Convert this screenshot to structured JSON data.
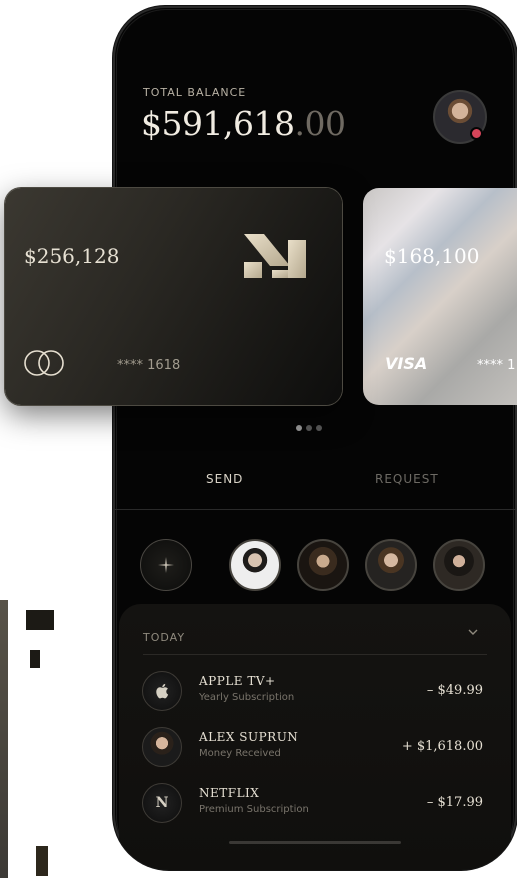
{
  "balance": {
    "label": "TOTAL BALANCE",
    "amount_main": "$591,618",
    "amount_cents": ".00"
  },
  "cards": [
    {
      "amount": "$256,128",
      "number": "**** 1618",
      "brand": "mastercard"
    },
    {
      "amount": "$168,100",
      "number": "**** 1",
      "brand": "VISA"
    }
  ],
  "tabs": {
    "send": "SEND",
    "request": "REQUEST",
    "active": "send"
  },
  "transactions": {
    "section_label": "TODAY",
    "items": [
      {
        "title": "APPLE TV+",
        "subtitle": "Yearly Subscription",
        "amount": "– $49.99",
        "icon": "apple-icon"
      },
      {
        "title": "ALEX SUPRUN",
        "subtitle": "Money Received",
        "amount": "+ $1,618.00",
        "icon": "avatar"
      },
      {
        "title": "NETFLIX",
        "subtitle": "Premium Subscription",
        "amount": "– $17.99",
        "icon_letter": "N"
      }
    ]
  },
  "colors": {
    "background": "#050505",
    "text_primary": "#f1ece2",
    "text_muted": "#6f6a62",
    "status_dot": "#d6455a"
  }
}
